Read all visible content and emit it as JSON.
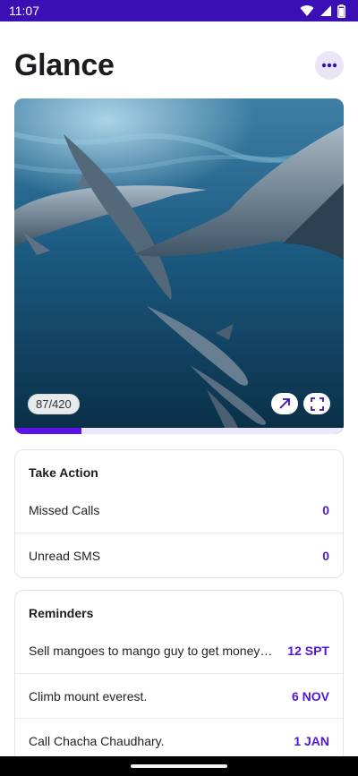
{
  "status": {
    "time": "11:07"
  },
  "header": {
    "title": "Glance"
  },
  "media": {
    "counter": "87/420",
    "progress": 0.205
  },
  "take_action": {
    "title": "Take Action",
    "rows": [
      {
        "label": "Missed Calls",
        "value": "0"
      },
      {
        "label": "Unread SMS",
        "value": "0"
      }
    ]
  },
  "reminders": {
    "title": "Reminders",
    "rows": [
      {
        "label": "Sell mangoes to mango guy to get money to buy grapes",
        "value": "12 SPT"
      },
      {
        "label": "Climb mount everest.",
        "value": "6 NOV"
      },
      {
        "label": "Call Chacha Chaudhary.",
        "value": "1 JAN"
      }
    ]
  },
  "colors": {
    "status_bar": "#3a0fb3",
    "accent": "#4f16d8",
    "progress": "#5a14e6"
  },
  "icons": [
    "wifi-icon",
    "signal-icon",
    "battery-icon",
    "more-horizontal-icon",
    "open-external-icon",
    "fullscreen-icon"
  ]
}
